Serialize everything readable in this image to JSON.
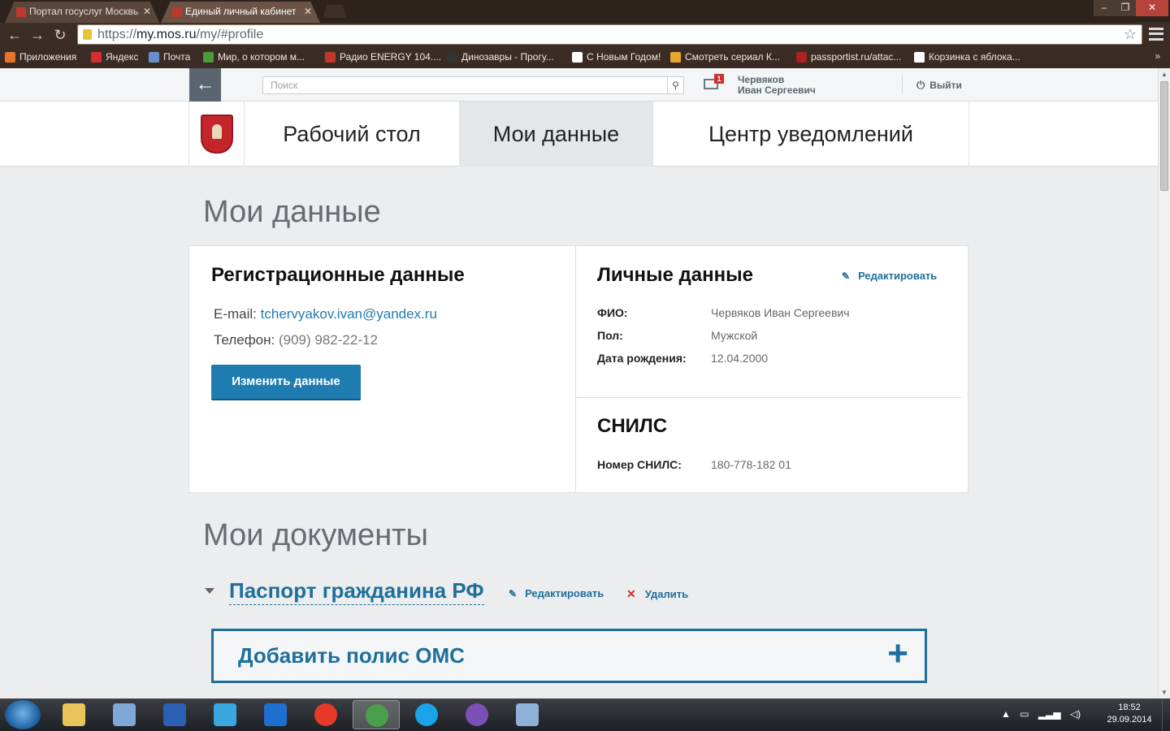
{
  "browser": {
    "tabs": [
      {
        "label": "Портал госуслуг Москвь"
      },
      {
        "label": "Единый личный кабинет"
      }
    ],
    "url_scheme": "https://",
    "url_host": "my.mos.ru",
    "url_path": "/my/#profile",
    "bookmarks": [
      {
        "label": "Приложения",
        "color": "#e8732a"
      },
      {
        "label": "Яндекс",
        "color": "#d42e2e"
      },
      {
        "label": "Почта",
        "color": "#6a8fd0"
      },
      {
        "label": "Мир, о котором м...",
        "color": "#4a9a3a"
      },
      {
        "label": "Радио ENERGY 104....",
        "color": "#c0382b"
      },
      {
        "label": "Динозавры - Прогу...",
        "color": "#333333"
      },
      {
        "label": "С Новым Годом!",
        "color": "#ffffff"
      },
      {
        "label": "Смотреть сериал К...",
        "color": "#e8a82a"
      },
      {
        "label": "passportist.ru/attac...",
        "color": "#b02020"
      },
      {
        "label": "Корзинка с яблока...",
        "color": "#ffffff"
      }
    ]
  },
  "header": {
    "search_placeholder": "Поиск",
    "mail_badge": "1",
    "user_lastname": "Червяков",
    "user_name": "Иван Сергеевич",
    "logout_label": "Выйти"
  },
  "nav": {
    "tabs": [
      {
        "label": "Рабочий стол"
      },
      {
        "label": "Мои данные"
      },
      {
        "label": "Центр уведомлений"
      }
    ]
  },
  "main": {
    "page_title": "Мои данные",
    "registration": {
      "title": "Регистрационные данные",
      "email_label": "E-mail:",
      "email_value": "tchervyakov.ivan@yandex.ru",
      "phone_label": "Телефон:",
      "phone_value": "(909) 982-22-12",
      "change_button": "Изменить данные"
    },
    "personal": {
      "title": "Личные данные",
      "edit_label": "Редактировать",
      "fields": [
        {
          "label": "ФИО:",
          "value": "Червяков Иван Сергеевич"
        },
        {
          "label": "Пол:",
          "value": "Мужской"
        },
        {
          "label": "Дата рождения:",
          "value": "12.04.2000"
        }
      ]
    },
    "snils": {
      "title": "СНИЛС",
      "label": "Номер СНИЛС:",
      "value": "180-778-182 01"
    },
    "documents": {
      "title": "Мои документы",
      "passport_title": "Паспорт гражданина РФ",
      "edit_label": "Редактировать",
      "delete_label": "Удалить",
      "add_oms_label": "Добавить полис ОМС"
    }
  },
  "taskbar": {
    "time": "18:52",
    "date": "29.09.2014",
    "apps": [
      {
        "name": "explorer-icon",
        "color": "#e8c45a"
      },
      {
        "name": "scanner-icon",
        "color": "#7fa8d8"
      },
      {
        "name": "word-icon",
        "color": "#2b5fb3"
      },
      {
        "name": "zoom-icon",
        "color": "#3aa7e0"
      },
      {
        "name": "teamviewer-icon",
        "color": "#1e6fd0"
      },
      {
        "name": "yandex-browser-icon",
        "color": "#e53a2a"
      },
      {
        "name": "chrome-icon",
        "color": "#4aa04a"
      },
      {
        "name": "skype-icon",
        "color": "#1aa3e8"
      },
      {
        "name": "viber-icon",
        "color": "#7a4fb8"
      },
      {
        "name": "paint-icon",
        "color": "#8fb0d8"
      }
    ]
  }
}
